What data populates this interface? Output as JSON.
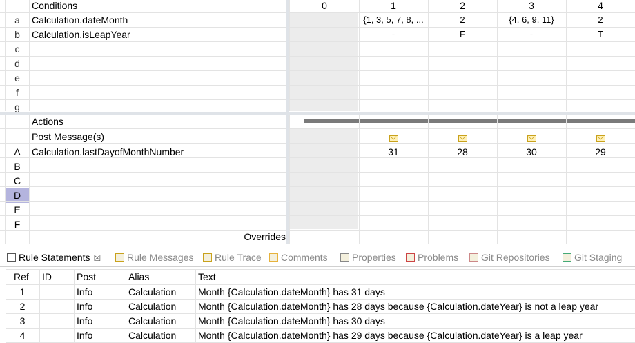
{
  "decision_table": {
    "conditions_header": "Conditions",
    "column_headers": [
      "0",
      "1",
      "2",
      "3",
      "4"
    ],
    "condition_rows": [
      {
        "id": "a",
        "label": "Calculation.dateMonth",
        "values": [
          "",
          "{1, 3, 5, 7, 8, ...",
          "2",
          "{4, 6, 9, 11}",
          "2"
        ]
      },
      {
        "id": "b",
        "label": "Calculation.isLeapYear",
        "values": [
          "",
          "-",
          "F",
          "-",
          "T"
        ]
      },
      {
        "id": "c",
        "label": "",
        "values": [
          "",
          "",
          "",
          "",
          ""
        ]
      },
      {
        "id": "d",
        "label": "",
        "values": [
          "",
          "",
          "",
          "",
          ""
        ]
      },
      {
        "id": "e",
        "label": "",
        "values": [
          "",
          "",
          "",
          "",
          ""
        ]
      },
      {
        "id": "f",
        "label": "",
        "values": [
          "",
          "",
          "",
          "",
          ""
        ]
      },
      {
        "id": "g",
        "label": "",
        "values": [
          "",
          "",
          "",
          "",
          ""
        ]
      }
    ],
    "actions_header": "Actions",
    "post_message_label": "Post Message(s)",
    "action_rows": [
      {
        "id": "A",
        "label": "Calculation.lastDayofMonthNumber",
        "values": [
          "",
          "31",
          "28",
          "30",
          "29"
        ]
      },
      {
        "id": "B",
        "label": "",
        "values": [
          "",
          "",
          "",
          "",
          ""
        ]
      },
      {
        "id": "C",
        "label": "",
        "values": [
          "",
          "",
          "",
          "",
          ""
        ]
      },
      {
        "id": "D",
        "label": "",
        "values": [
          "",
          "",
          "",
          "",
          ""
        ]
      },
      {
        "id": "E",
        "label": "",
        "values": [
          "",
          "",
          "",
          "",
          ""
        ]
      },
      {
        "id": "F",
        "label": "",
        "values": [
          "",
          "",
          "",
          "",
          ""
        ]
      }
    ],
    "overrides_label": "Overrides",
    "selected_action_row": "D",
    "selected_color": "#b4b4de"
  },
  "bottom_tabs": [
    {
      "label": "Rule Statements",
      "icon": "rule-statements-icon",
      "active": true,
      "close": "☒"
    },
    {
      "label": "Rule Messages",
      "icon": "envelope-icon",
      "active": false
    },
    {
      "label": "Rule Trace",
      "icon": "envelope-icon",
      "active": false
    },
    {
      "label": "Comments",
      "icon": "comment-bubble-icon",
      "active": false
    },
    {
      "label": "Properties",
      "icon": "properties-icon",
      "active": false
    },
    {
      "label": "Problems",
      "icon": "problems-icon",
      "active": false
    },
    {
      "label": "Git Repositories",
      "icon": "git-repositories-icon",
      "active": false
    },
    {
      "label": "Git Staging",
      "icon": "git-staging-icon",
      "active": false
    }
  ],
  "rule_statements": {
    "columns": [
      "Ref",
      "ID",
      "Post",
      "Alias",
      "Text"
    ],
    "rows": [
      {
        "ref": "1",
        "id": "",
        "post": "Info",
        "alias": "Calculation",
        "text": "Month {Calculation.dateMonth} has 31 days"
      },
      {
        "ref": "2",
        "id": "",
        "post": "Info",
        "alias": "Calculation",
        "text": "Month {Calculation.dateMonth} has 28 days because {Calculation.dateYear} is not a leap year"
      },
      {
        "ref": "3",
        "id": "",
        "post": "Info",
        "alias": "Calculation",
        "text": "Month {Calculation.dateMonth} has 30 days"
      },
      {
        "ref": "4",
        "id": "",
        "post": "Info",
        "alias": "Calculation",
        "text": "Month {Calculation.dateMonth} has 29 days because {Calculation.dateYear} is a leap year"
      }
    ]
  }
}
